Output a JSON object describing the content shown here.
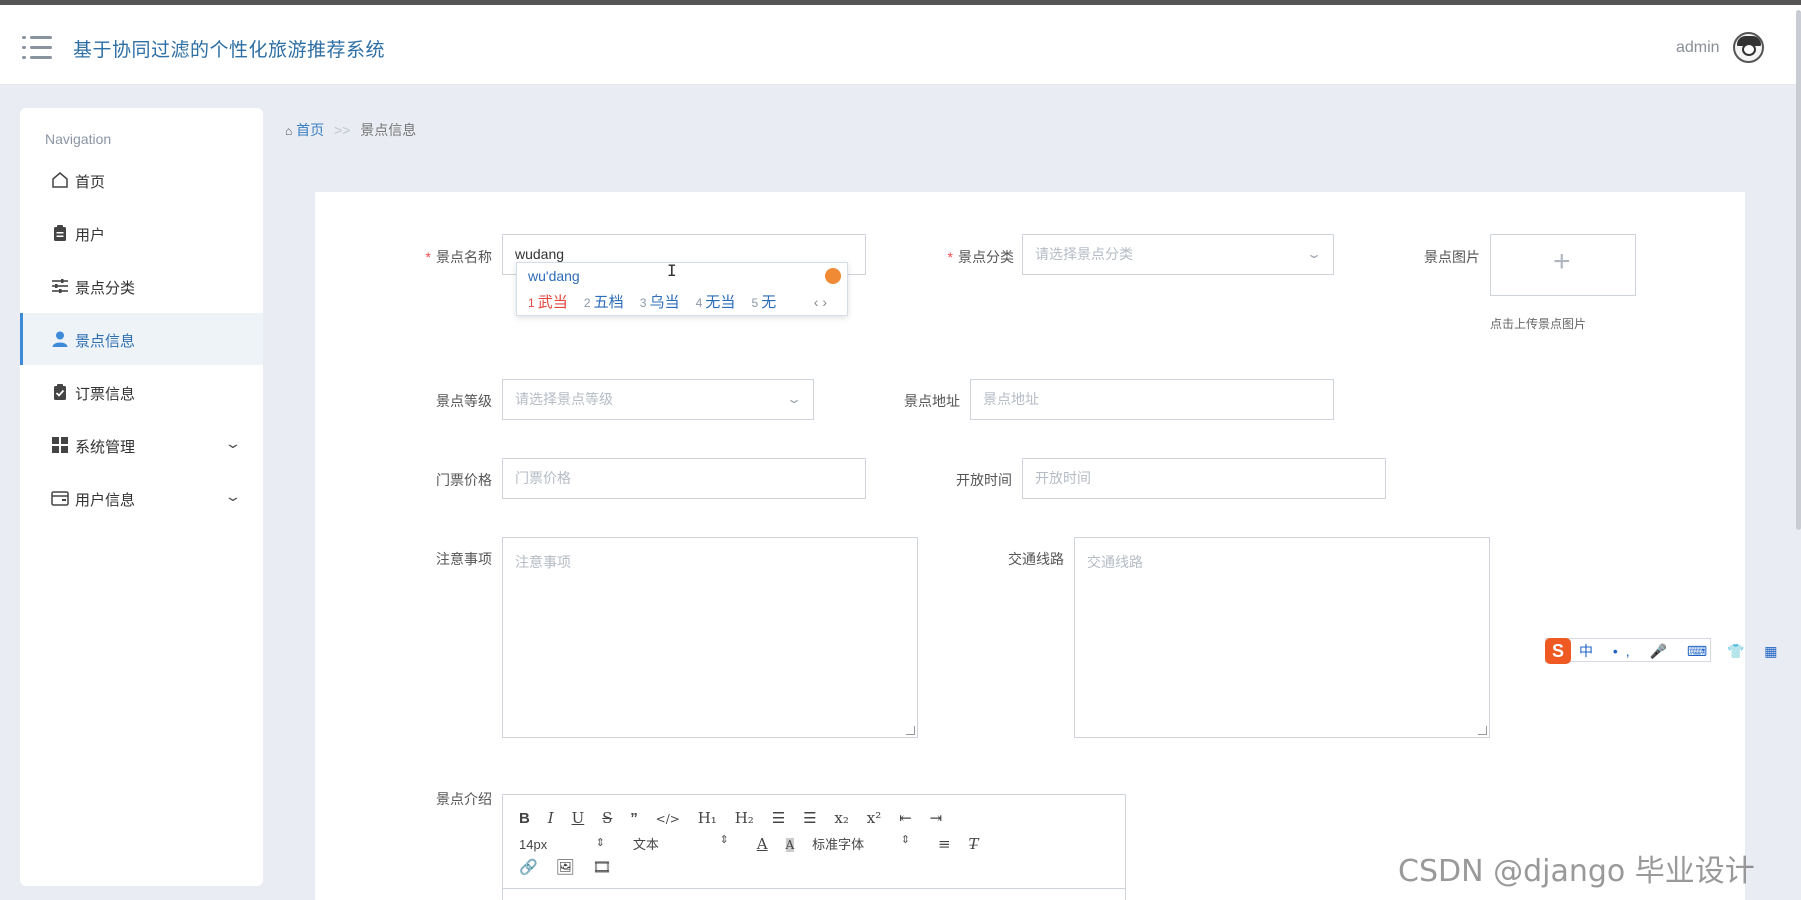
{
  "app": {
    "title": "基于协同过滤的个性化旅游推荐系统",
    "user": "admin"
  },
  "nav": {
    "title": "Navigation",
    "items": [
      {
        "label": "首页",
        "icon": "home-icon"
      },
      {
        "label": "用户",
        "icon": "clipboard-icon"
      },
      {
        "label": "景点分类",
        "icon": "sliders-icon"
      },
      {
        "label": "景点信息",
        "icon": "user-icon",
        "active": true
      },
      {
        "label": "订票信息",
        "icon": "clipboard-check-icon"
      },
      {
        "label": "系统管理",
        "icon": "grid-icon",
        "expandable": true
      },
      {
        "label": "用户信息",
        "icon": "card-icon",
        "expandable": true
      }
    ]
  },
  "breadcrumb": {
    "home": "首页",
    "separator": ">>",
    "current": "景点信息"
  },
  "form": {
    "name": {
      "label": "景点名称",
      "value": "wudang"
    },
    "category": {
      "label": "景点分类",
      "placeholder": "请选择景点分类"
    },
    "image": {
      "label": "景点图片",
      "hint": "点击上传景点图片"
    },
    "level": {
      "label": "景点等级",
      "placeholder": "请选择景点等级"
    },
    "address": {
      "label": "景点地址",
      "placeholder": "景点地址"
    },
    "price": {
      "label": "门票价格",
      "placeholder": "门票价格"
    },
    "open_time": {
      "label": "开放时间",
      "placeholder": "开放时间"
    },
    "notes": {
      "label": "注意事项",
      "placeholder": "注意事项"
    },
    "transport": {
      "label": "交通线路",
      "placeholder": "交通线路"
    },
    "intro": {
      "label": "景点介绍"
    }
  },
  "ime": {
    "pinyin": "wu'dang",
    "candidates": [
      {
        "num": "1",
        "text": "武当"
      },
      {
        "num": "2",
        "text": "五档"
      },
      {
        "num": "3",
        "text": "乌当"
      },
      {
        "num": "4",
        "text": "无当"
      },
      {
        "num": "5",
        "text": "无"
      }
    ],
    "nav": "‹ ›",
    "toolbar_logo": "S",
    "toolbar_items": "中 •, 🎤 ⌨ 👕 ▦"
  },
  "editor": {
    "size": "14px",
    "format": "文本",
    "font": "标准字体"
  },
  "watermark": "CSDN @django 毕业设计"
}
